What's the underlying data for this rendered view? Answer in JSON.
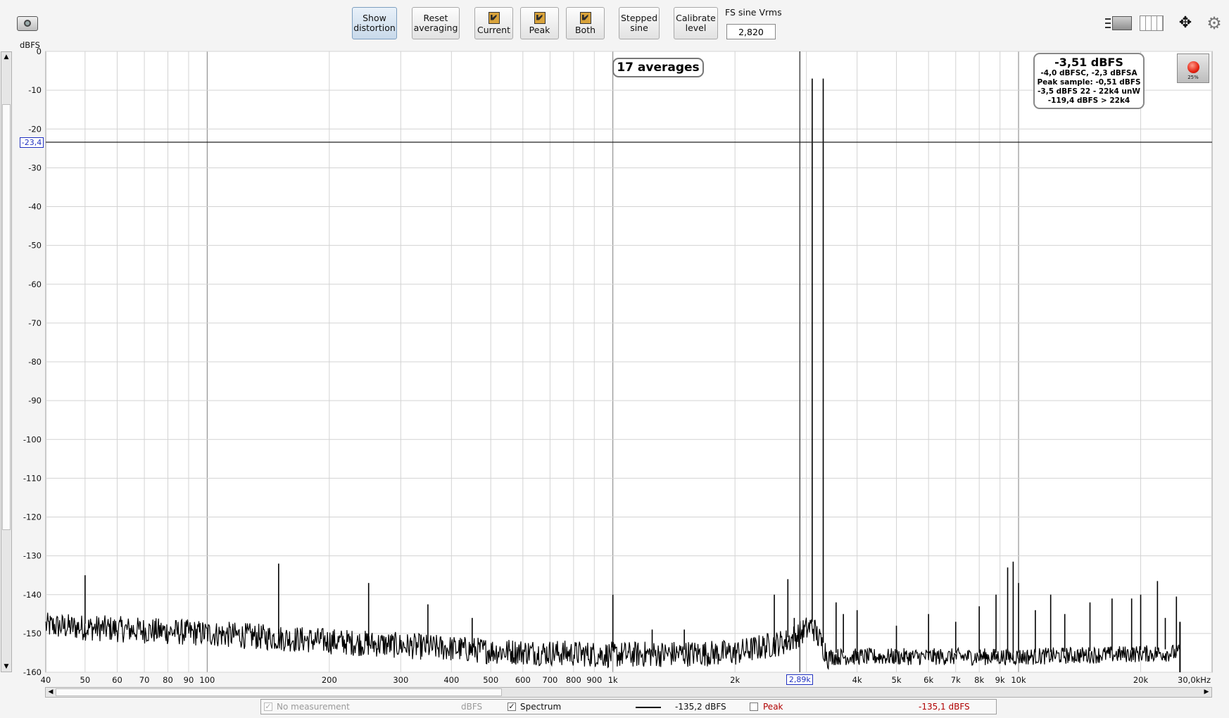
{
  "toolbar": {
    "show_distortion": [
      "Show",
      "distortion"
    ],
    "reset_averaging": [
      "Reset",
      "averaging"
    ],
    "current": "Current",
    "peak": "Peak",
    "both": "Both",
    "stepped_sine": [
      "Stepped",
      "sine"
    ],
    "calibrate_level": [
      "Calibrate",
      "level"
    ],
    "fs_sine_label": "FS sine Vrms",
    "fs_sine_value": "2,820"
  },
  "readout": {
    "main": "-3,51 dBFS",
    "lines": [
      "-4,0 dBFSC, -2,3 dBFSA",
      "Peak sample: -0,51 dBFS",
      "-3,5 dBFS 22 - 22k4 unW",
      "-119,4 dBFS > 22k4"
    ]
  },
  "clip_percent": "25%",
  "averages_label": "17 averages",
  "cursor": {
    "y_label": "-23,4",
    "x_label": "2,89k",
    "y_value": -23.4,
    "x_value": 2890
  },
  "statusbar": {
    "no_measurement": "No measurement",
    "units": "dBFS",
    "spectrum": "Spectrum",
    "spectrum_value": "-135,2 dBFS",
    "peak": "Peak",
    "peak_value": "-135,1 dBFS",
    "peak_color": "#b00000"
  },
  "chart_data": {
    "type": "line",
    "title": "",
    "xlabel": "",
    "ylabel": "dBFS",
    "x_unit_label": "30,0kHz",
    "xscale": "log",
    "xlim": [
      40,
      30000
    ],
    "ylim": [
      -160,
      0
    ],
    "grid": true,
    "xticks": [
      {
        "v": 40,
        "t": "40"
      },
      {
        "v": 50,
        "t": "50"
      },
      {
        "v": 60,
        "t": "60"
      },
      {
        "v": 70,
        "t": "70"
      },
      {
        "v": 80,
        "t": "80"
      },
      {
        "v": 90,
        "t": "90"
      },
      {
        "v": 100,
        "t": "100"
      },
      {
        "v": 200,
        "t": "200"
      },
      {
        "v": 300,
        "t": "300"
      },
      {
        "v": 400,
        "t": "400"
      },
      {
        "v": 500,
        "t": "500"
      },
      {
        "v": 600,
        "t": "600"
      },
      {
        "v": 700,
        "t": "700"
      },
      {
        "v": 800,
        "t": "800"
      },
      {
        "v": 900,
        "t": "900"
      },
      {
        "v": 1000,
        "t": "1k"
      },
      {
        "v": 2000,
        "t": "2k"
      },
      {
        "v": 4000,
        "t": "4k"
      },
      {
        "v": 5000,
        "t": "5k"
      },
      {
        "v": 6000,
        "t": "6k"
      },
      {
        "v": 7000,
        "t": "7k"
      },
      {
        "v": 8000,
        "t": "8k"
      },
      {
        "v": 9000,
        "t": "9k"
      },
      {
        "v": 10000,
        "t": "10k"
      },
      {
        "v": 20000,
        "t": "20k"
      }
    ],
    "yticks": [
      0,
      -10,
      -20,
      -30,
      -40,
      -50,
      -60,
      -70,
      -80,
      -90,
      -100,
      -110,
      -120,
      -130,
      -140,
      -150,
      -160
    ],
    "series": [
      {
        "color": "#000000",
        "noise_floor": [
          [
            40,
            -148
          ],
          [
            100,
            -150
          ],
          [
            200,
            -152
          ],
          [
            500,
            -154.5
          ],
          [
            1000,
            -155.5
          ],
          [
            2000,
            -155
          ],
          [
            2700,
            -152
          ],
          [
            3100,
            -148
          ],
          [
            3400,
            -156
          ],
          [
            10000,
            -156
          ],
          [
            25000,
            -155
          ]
        ],
        "peaks": [
          [
            50,
            -135
          ],
          [
            150,
            -132
          ],
          [
            250,
            -137
          ],
          [
            350,
            -142.5
          ],
          [
            450,
            -146
          ],
          [
            1000,
            -140
          ],
          [
            1250,
            -149
          ],
          [
            1500,
            -149
          ],
          [
            2500,
            -140
          ],
          [
            2700,
            -136
          ],
          [
            2800,
            -146
          ],
          [
            3100,
            -7
          ],
          [
            3300,
            -7
          ],
          [
            3550,
            -142
          ],
          [
            3700,
            -145
          ],
          [
            4000,
            -144
          ],
          [
            5000,
            -148
          ],
          [
            6000,
            -145
          ],
          [
            7000,
            -147
          ],
          [
            8000,
            -143
          ],
          [
            8800,
            -140
          ],
          [
            9400,
            -133
          ],
          [
            9700,
            -131.5
          ],
          [
            10000,
            -137
          ],
          [
            11000,
            -144
          ],
          [
            12000,
            -140
          ],
          [
            13000,
            -145
          ],
          [
            15000,
            -142
          ],
          [
            17000,
            -141
          ],
          [
            19000,
            -141
          ],
          [
            20000,
            -140
          ],
          [
            22000,
            -136.5
          ],
          [
            23000,
            -146
          ],
          [
            24500,
            -140.5
          ]
        ]
      }
    ]
  }
}
